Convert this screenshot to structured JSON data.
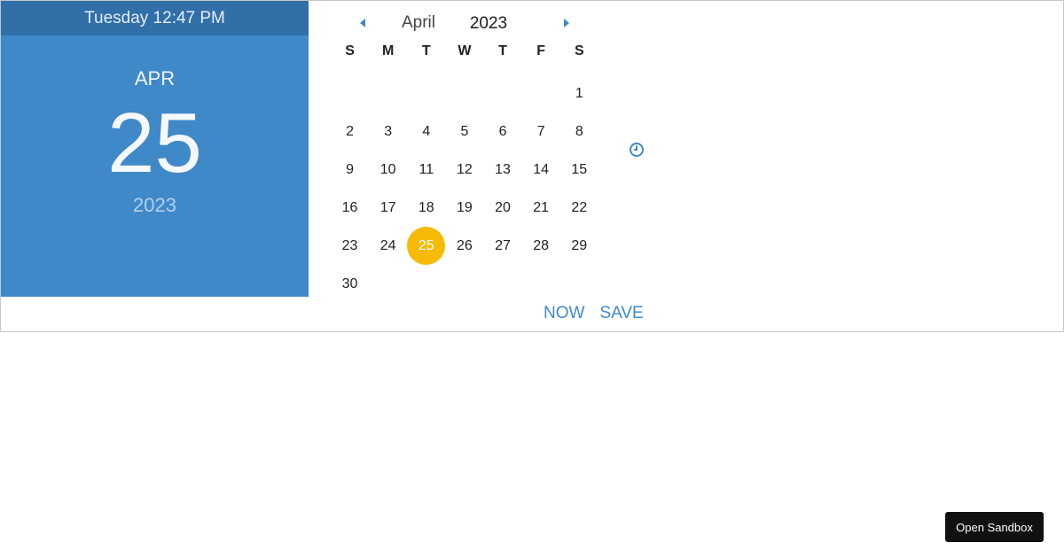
{
  "header": {
    "dayline": "Tuesday 12:47 PM",
    "month_abbr": "APR",
    "day": "25",
    "year": "2023"
  },
  "calendar": {
    "month": "April",
    "year": "2023",
    "weekdays": [
      "S",
      "M",
      "T",
      "W",
      "T",
      "F",
      "S"
    ],
    "leading_blank_days": 6,
    "days": [
      "1",
      "2",
      "3",
      "4",
      "5",
      "6",
      "7",
      "8",
      "9",
      "10",
      "11",
      "12",
      "13",
      "14",
      "15",
      "16",
      "17",
      "18",
      "19",
      "20",
      "21",
      "22",
      "23",
      "24",
      "25",
      "26",
      "27",
      "28",
      "29",
      "30"
    ],
    "selected_day": "25",
    "icons": {
      "prev": "chevron-left-icon",
      "next": "chevron-right-icon",
      "clock": "clock-icon"
    }
  },
  "actions": {
    "now_label": "NOW",
    "save_label": "SAVE"
  },
  "sandbox": {
    "label": "Open Sandbox"
  },
  "colors": {
    "primary": "#3f89c9",
    "primary_dark": "#306fa8",
    "selected": "#f7bb07"
  }
}
